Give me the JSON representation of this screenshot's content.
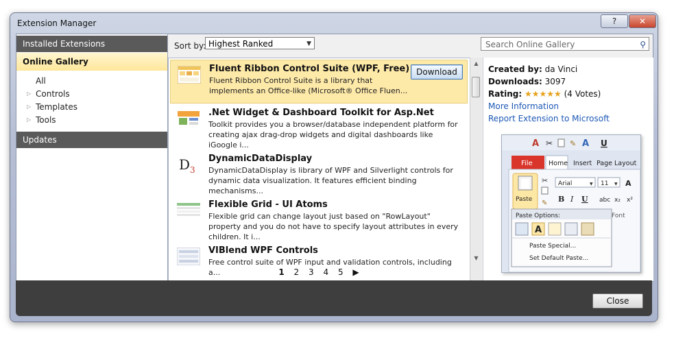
{
  "window": {
    "title": "Extension Manager",
    "help_label": "?",
    "close_label": "✕"
  },
  "left_nav": {
    "installed": "Installed Extensions",
    "online": "Online Gallery",
    "tree": [
      "All",
      "Controls",
      "Templates",
      "Tools"
    ],
    "updates": "Updates"
  },
  "sortbar": {
    "label": "Sort by:",
    "value": "Highest Ranked",
    "search_placeholder": "Search Online Gallery"
  },
  "items": [
    {
      "title": "Fluent Ribbon Control Suite (WPF, Free)",
      "desc": "Fluent Ribbon Control Suite is a library that implements an Office-like (Microsoft® Office Fluen...",
      "button": "Download"
    },
    {
      "title": ".Net Widget & Dashboard Toolkit for Asp.Net",
      "desc": "Toolkit provides you a browser/database independent platform for creating ajax drag-drop widgets and digital dashboards like iGoogle i..."
    },
    {
      "title": "DynamicDataDisplay",
      "desc": "DynamicDataDisplay is library of WPF and Silverlight controls for dynamic data visualization. It features efficient binding mechanisms..."
    },
    {
      "title": "Flexible Grid - UI Atoms",
      "desc": "Flexible grid can change layout just based on \"RowLayout\" property and you do not have to specify layout attributes in every children. It i..."
    },
    {
      "title": "VIBlend WPF Controls",
      "desc": "Free control suite of WPF input and validation controls, including a..."
    }
  ],
  "pager": {
    "pages": [
      "1",
      "2",
      "3",
      "4",
      "5"
    ],
    "next": "▶"
  },
  "details": {
    "created_label": "Created by:",
    "created_value": "da Vinci",
    "downloads_label": "Downloads:",
    "downloads_value": "3097",
    "rating_label": "Rating:",
    "rating_stars": "★★★★★",
    "rating_votes": "(4 Votes)",
    "more_info": "More Information",
    "report": "Report Extension to Microsoft"
  },
  "preview": {
    "tab_file": "File",
    "tab_home": "Home",
    "tab_insert": "Insert",
    "tab_layout": "Page Layout",
    "paste": "Paste",
    "font_name": "Arial",
    "font_size": "11",
    "paste_options": "Paste Options:",
    "paste_special": "Paste Special...",
    "set_default": "Set Default Paste...",
    "font_group": "Font",
    "bold": "B",
    "italic": "I",
    "underline": "U",
    "letter_a": "A"
  },
  "footer": {
    "close": "Close"
  },
  "colors": {
    "selected_row": "#fde9a8",
    "nav_header": "#5a5a5a",
    "link": "#1b57b5"
  }
}
